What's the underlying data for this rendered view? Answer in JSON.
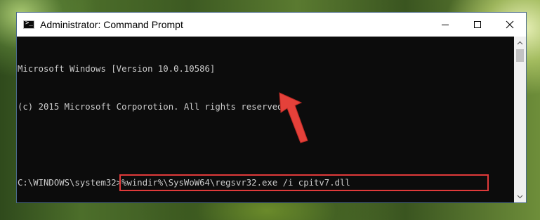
{
  "window": {
    "title": "Administrator: Command Prompt",
    "controls": {
      "minimize_icon": "minimize-icon",
      "maximize_icon": "maximize-icon",
      "close_icon": "close-icon"
    }
  },
  "console": {
    "lines": [
      "Microsoft Windows [Version 10.0.10586]",
      "(c) 2015 Microsoft Corporotion. All rights reserved.",
      ""
    ],
    "prompt": "C:\\WINDOWS\\system32>",
    "command": "%windir%\\SysWoW64\\regsvr32.exe /i cpitv7.dll"
  },
  "annotation": {
    "highlight_color": "#e03a3a",
    "arrow_color": "#e03a3a",
    "arrow_icon": "red-arrow-icon"
  }
}
